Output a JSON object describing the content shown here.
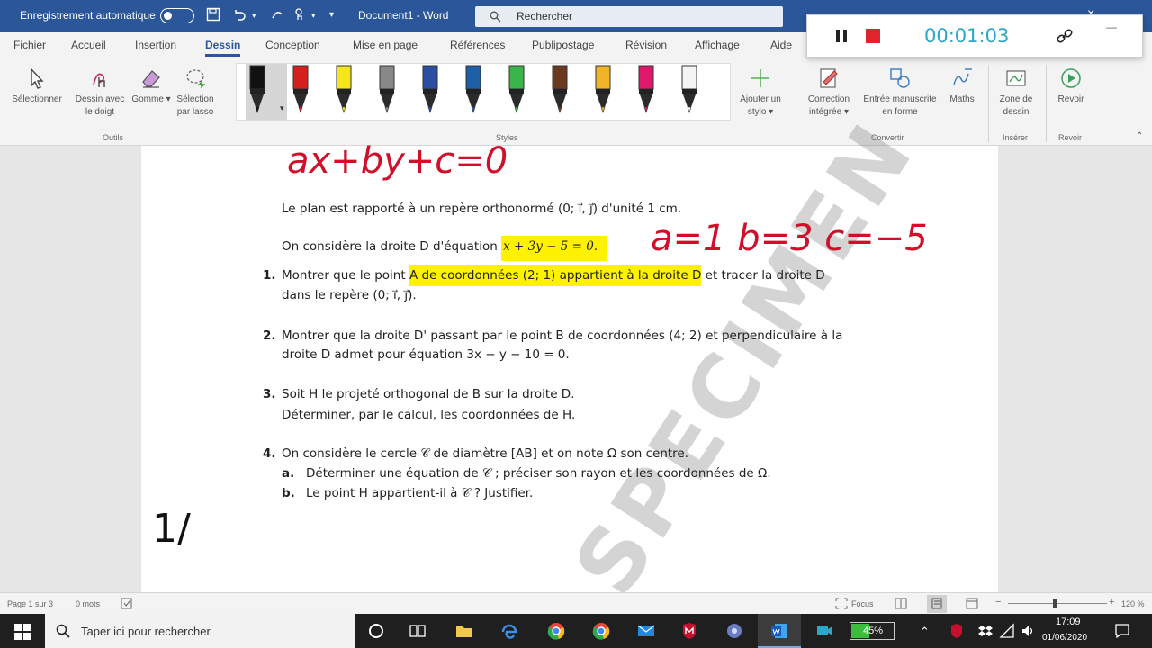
{
  "titlebar": {
    "autosave_label": "Enregistrement automatique",
    "doc_title": "Document1 - Word",
    "search_placeholder": "Rechercher"
  },
  "tabs": [
    "Fichier",
    "Accueil",
    "Insertion",
    "Dessin",
    "Conception",
    "Mise en page",
    "Références",
    "Publipostage",
    "Révision",
    "Affichage",
    "Aide"
  ],
  "active_tab": "Dessin",
  "ribbon": {
    "tools": [
      {
        "label1": "Sélectionner",
        "label2": ""
      },
      {
        "label1": "Dessin avec",
        "label2": "le doigt"
      },
      {
        "label1": "Gomme",
        "label2": "▾"
      },
      {
        "label1": "Sélection",
        "label2": "par lasso"
      }
    ],
    "group_tools": "Outils",
    "group_styles": "Styles",
    "pen_colors": [
      "#111111",
      "#d62020",
      "#f5e61a",
      "#888888",
      "#2a4fa0",
      "#1f5fa8",
      "#3bb54a",
      "#6b3a1e",
      "#f0b429",
      "#e0186c",
      "#f4f4f4"
    ],
    "add_pen_1": "Ajouter un",
    "add_pen_2": "stylo ▾",
    "convert": [
      {
        "label1": "Correction",
        "label2": "intégrée ▾"
      },
      {
        "label1": "Entrée manuscrite",
        "label2": "en forme"
      },
      {
        "label1": "Maths",
        "label2": ""
      }
    ],
    "group_convert": "Convertir",
    "zone_label1": "Zone de",
    "zone_label2": "dessin",
    "group_insert": "Insérer",
    "replay_label": "Revoir",
    "group_replay": "Revoir"
  },
  "recorder": {
    "timer": "00:01:03"
  },
  "document": {
    "handwritten_top": "ax+by+c=0",
    "intro": "Le plan est rapporté à un repère orthonormé (0; ı⃗, ȷ⃗) d'unité 1 cm.",
    "line2_prefix": "On considère la droite D d'équation ",
    "line2_eq": "x + 3y − 5 = 0.",
    "handwritten_abc": "a=1 b=3 c=−5",
    "q1_num": "1.",
    "q1_pre": "Montrer que le point ",
    "q1_hl": "A de coordonnées (2; 1) appartient à la droite D",
    "q1_post": " et tracer la droite D",
    "q1_line2": "dans le repère (0; ı⃗, ȷ⃗).",
    "q2_num": "2.",
    "q2_line1": "Montrer que la droite D' passant par le point B de coordonnées (4; 2) et perpendiculaire à la",
    "q2_line2": "droite D admet pour équation 3x − y − 10 = 0.",
    "q3_num": "3.",
    "q3_line1": "Soit H le projeté orthogonal de B sur la droite D.",
    "q3_line2": "Déterminer, par le calcul, les coordonnées de H.",
    "q4_num": "4.",
    "q4_line1": "On considère le cercle 𝒞 de diamètre [AB] et on note Ω son centre.",
    "q4a_num": "a.",
    "q4a": "Déterminer une équation de 𝒞 ; préciser son rayon et les coordonnées de Ω.",
    "q4b_num": "b.",
    "q4b": "Le point H appartient-il à  𝒞 ? Justifier.",
    "watermark": "SPECIMEN",
    "handwritten_1": "1/"
  },
  "statusbar": {
    "page": "Page 1 sur 3",
    "words": "0 mots",
    "focus": "Focus",
    "zoom": "120 %"
  },
  "taskbar": {
    "search_placeholder": "Taper ici pour rechercher",
    "battery": "45%",
    "time": "17:09",
    "date": "01/06/2020"
  }
}
